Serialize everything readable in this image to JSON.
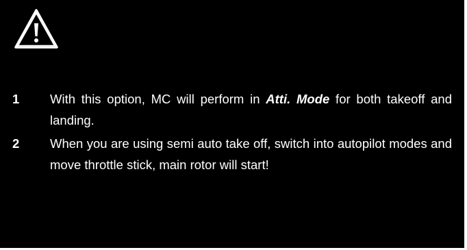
{
  "icon": "warning-triangle-icon",
  "notes": [
    {
      "num": "1",
      "text_before": "With this option, MC will perform in ",
      "emphasis": "Atti. Mode",
      "text_after": " for both takeoff and landing."
    },
    {
      "num": "2",
      "text": "When you are using semi auto take off, switch into autopilot modes and move throttle stick, main rotor will start!"
    }
  ]
}
